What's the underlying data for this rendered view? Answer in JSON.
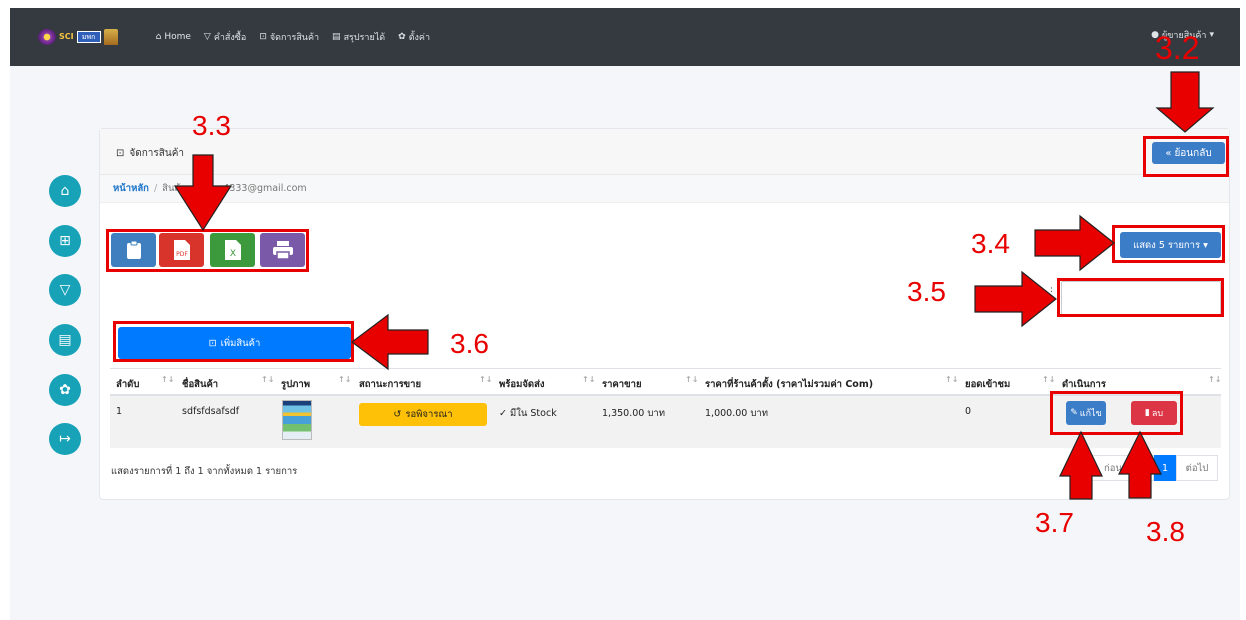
{
  "navbar": {
    "logo_badge": "มพก",
    "logo_text": "SCI",
    "links": [
      {
        "icon": "home-icon",
        "glyph": "⌂",
        "label": "Home"
      },
      {
        "icon": "cart-icon",
        "glyph": "▽",
        "label": "คำสั่งซื้อ"
      },
      {
        "icon": "product-icon",
        "glyph": "⊡",
        "label": "จัดการสินค้า"
      },
      {
        "icon": "report-icon",
        "glyph": "▤",
        "label": "สรุปรายได้"
      },
      {
        "icon": "gear-icon",
        "glyph": "✿",
        "label": "ตั้งค่า"
      }
    ],
    "user_label": "ผู้ขายสินค้า"
  },
  "sidebar": [
    "home-icon",
    "add-product-icon",
    "cart-icon",
    "report-icon",
    "gear-icon",
    "logout-icon"
  ],
  "card": {
    "title": "จัดการสินค้า",
    "back_label": "ย้อนกลับ",
    "breadcrumb": {
      "home": "หน้าหลัก",
      "current_prefix": "สินค้า",
      "current_email": "ณ: lion4333@gmail.com"
    },
    "export_buttons": [
      {
        "name": "clipboard-button",
        "color": "#3f7fbf"
      },
      {
        "name": "pdf-button",
        "color": "#d9342b",
        "label": "PDF"
      },
      {
        "name": "excel-button",
        "color": "#3c9a3c",
        "label": "X"
      },
      {
        "name": "print-button",
        "color": "#7a5aa8"
      }
    ],
    "show_entries_label": "แสดง 5 รายการ ▾",
    "search_label": ":",
    "add_product_label": "เพิ่มสินค้า",
    "table": {
      "headers": [
        "ลำดับ",
        "ชื่อสินค้า",
        "รูปภาพ",
        "สถานะการขาย",
        "พร้อมจัดส่ง",
        "ราคาขาย",
        "ราคาที่ร้านค้าตั้ง (ราคาไม่รวมค่า Com)",
        "ยอดเข้าชม",
        "ดำเนินการ"
      ],
      "rows": [
        {
          "no": "1",
          "name": "sdfsfdsafsdf",
          "status": "รอพิจารณา",
          "ready": "มีใน Stock",
          "price": "1,350.00 บาท",
          "shop_price": "1,000.00 บาท",
          "views": "0",
          "edit_label": "แก้ไข",
          "delete_label": "ลบ"
        }
      ]
    },
    "info": "แสดงรายการที่ 1 ถึง 1 จากทั้งหมด 1 รายการ",
    "pager": {
      "prev": "ก่อนหน้า",
      "current": "1",
      "next": "ต่อไป"
    }
  },
  "annotations": [
    "3.2",
    "3.3",
    "3.4",
    "3.5",
    "3.6",
    "3.7",
    "3.8"
  ],
  "colors": {
    "navbar": "#343a40",
    "accent": "#007bff",
    "primary": "#3c7dc8",
    "teal": "#17a2b8",
    "warning": "#ffc107",
    "danger": "#dc3545",
    "annotation": "#e80000"
  }
}
